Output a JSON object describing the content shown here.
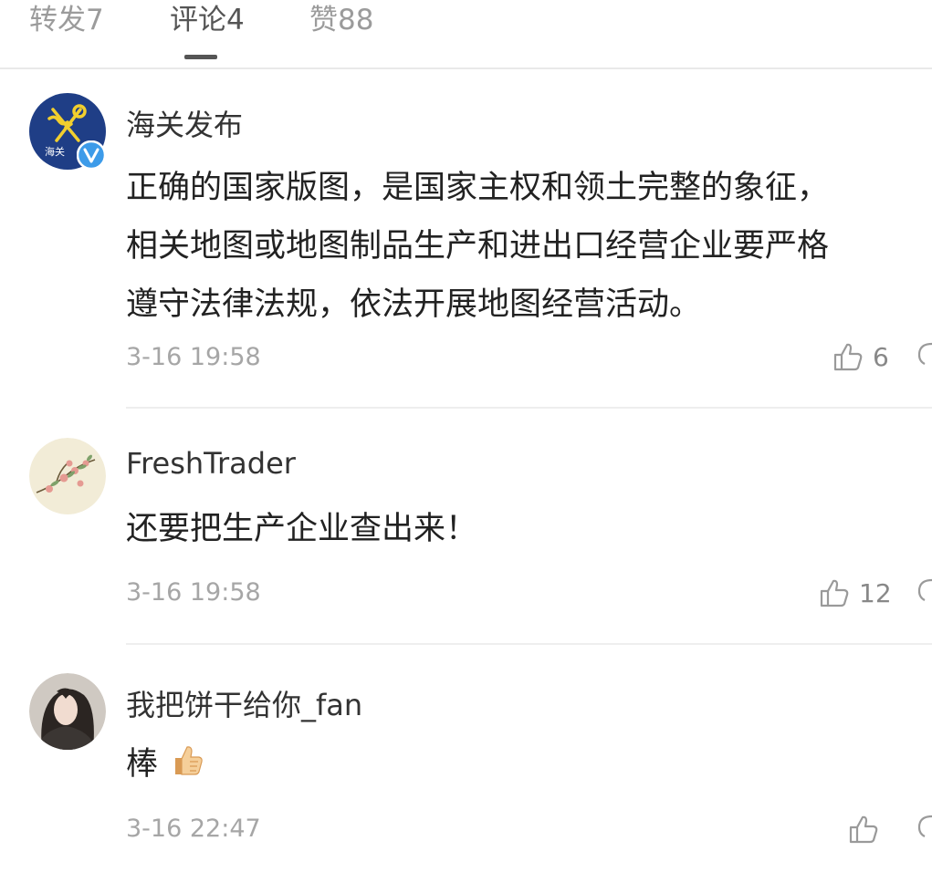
{
  "tabs": {
    "repost": "转发7",
    "comments": "评论4",
    "likes": "赞88"
  },
  "comments": [
    {
      "username": "海关发布",
      "avatar_text": "海关",
      "verified": true,
      "lines": [
        "正确的国家版图，是国家主权和领土完整的象征，",
        "相关地图或地图制品生产和进出口经营企业要严格",
        "遵守法律法规，依法开展地图经营活动。"
      ],
      "time": "3-16 19:58",
      "likes": "6"
    },
    {
      "username": "FreshTrader",
      "lines": [
        "还要把生产企业查出来！"
      ],
      "time": "3-16 19:58",
      "likes": "12"
    },
    {
      "username": "我把饼干给你_fan",
      "lines": [
        "棒"
      ],
      "emoji": "thumbs-up",
      "time": "3-16 22:47",
      "likes": ""
    }
  ],
  "colors": {
    "text_main": "#222222",
    "text_secondary": "#a6a6a6",
    "tab_inactive": "#9b9b9b",
    "tab_active": "#555555",
    "customs_avatar_bg": "#1f3e86",
    "customs_emblem": "#f2cf2e",
    "verified_badge": "#3d9be9"
  }
}
